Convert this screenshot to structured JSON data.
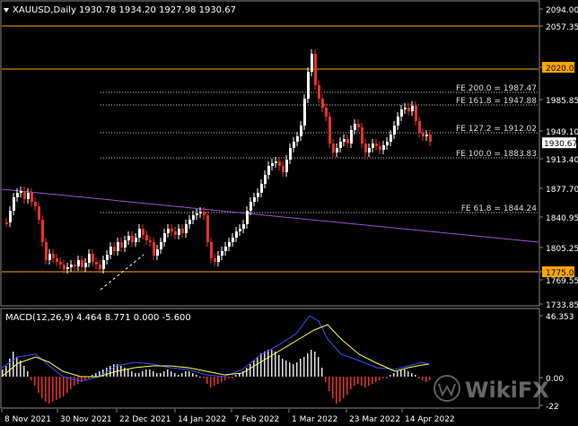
{
  "header": {
    "symbol": "XAUUSD,Daily",
    "ohlc": "1930.78 1934.20 1927.98 1930.67"
  },
  "price_axis": {
    "ticks": [
      "2094.00",
      "2057.35",
      "2020.00",
      "1985.85",
      "1949.10",
      "1913.40",
      "1877.70",
      "1840.95",
      "1805.25",
      "1775.00",
      "1769.55",
      "1733.85"
    ],
    "current_price": "1930.67"
  },
  "levels": [
    {
      "label": "2075.00",
      "value": 2075.0
    },
    {
      "label": "2020.00",
      "value": 2020.0
    },
    {
      "label": "1775.00",
      "value": 1775.0
    }
  ],
  "fibs": [
    {
      "label": "FE 200.0 = 1987.47",
      "value": 1987.47
    },
    {
      "label": "FE 161.8 = 1947.88",
      "value": 1947.88
    },
    {
      "label": "FE 127.2 = 1912.02",
      "value": 1912.02
    },
    {
      "label": "FE 100.0 = 1883.83",
      "value": 1883.83
    },
    {
      "label": "FE 61.8 = 1844.24",
      "value": 1844.24
    }
  ],
  "macd": {
    "label": "MACD(12,26,9) 4.464 8.771 0.000 -5.600",
    "ticks": [
      "46.353",
      "0.00",
      "-22"
    ]
  },
  "time_axis": [
    "8 Nov 2021",
    "30 Nov 2021",
    "22 Dec 2021",
    "14 Jan 2022",
    "7 Feb 2022",
    "1 Mar 2022",
    "23 Mar 2022",
    "14 Apr 2022"
  ],
  "watermark": "WikiFX",
  "colors": {
    "background": "#000000",
    "bull": "#ffffff",
    "bear": "#e8322a",
    "level": "#ffa500",
    "trendline": "#9c4fd4",
    "macd_line": "#3d4fff",
    "signal_line": "#ffff55"
  }
}
